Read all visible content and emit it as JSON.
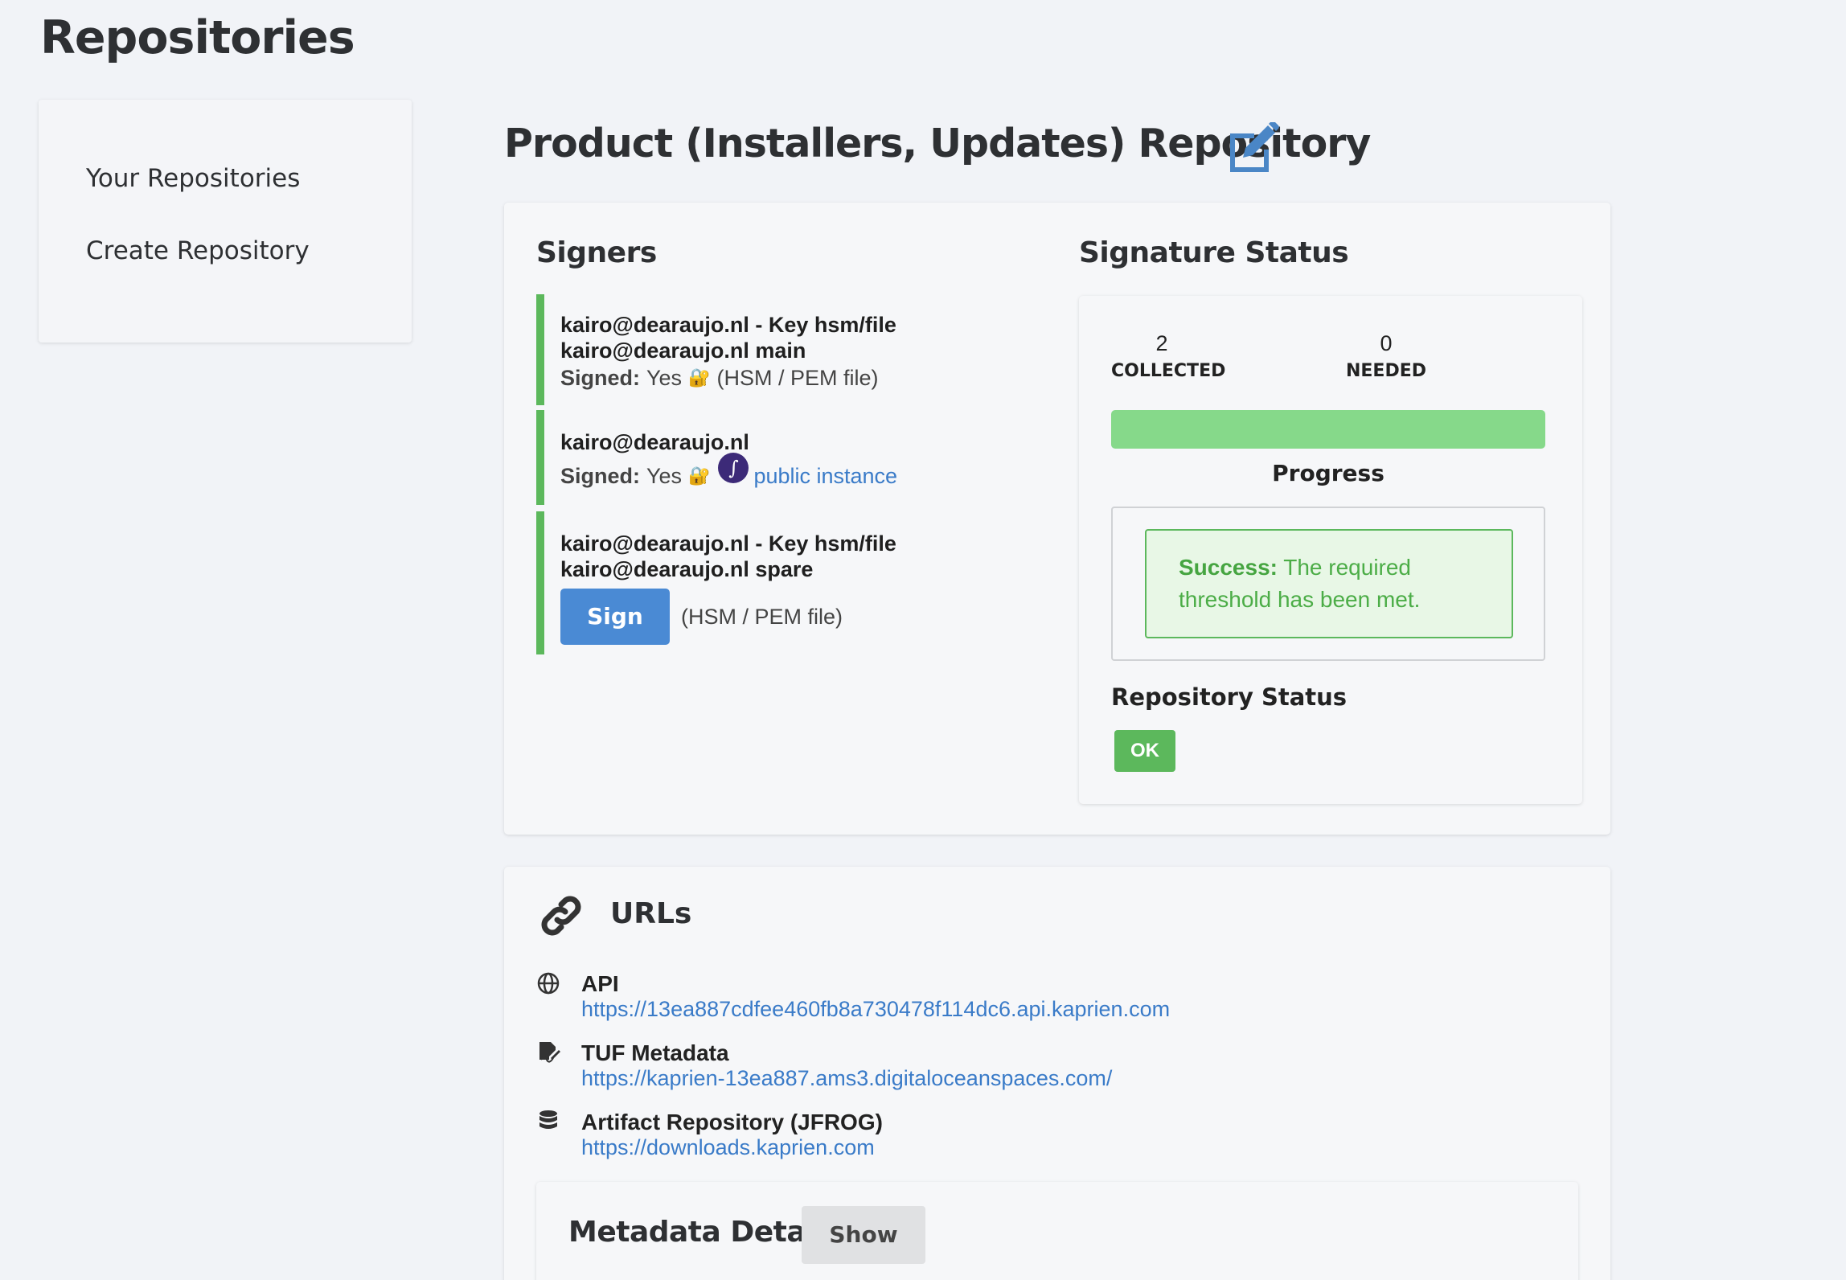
{
  "page_title": "Repositories",
  "sidebar": {
    "items": [
      {
        "label": "Your Repositories"
      },
      {
        "label": "Create Repository"
      }
    ]
  },
  "repo": {
    "title": "Product (Installers, Updates) Repository",
    "edit_icon": "edit-icon"
  },
  "signers": {
    "heading": "Signers",
    "list": [
      {
        "line1": "kairo@dearaujo.nl - Key hsm/file",
        "line2": "kairo@dearaujo.nl main",
        "signed_label": "Signed:",
        "signed_value": "Yes",
        "method": "(HSM / PEM file)"
      },
      {
        "line1": "kairo@dearaujo.nl",
        "signed_label": "Signed:",
        "signed_value": "Yes",
        "method": "public instance"
      },
      {
        "line1": "kairo@dearaujo.nl - Key hsm/file",
        "line2": "kairo@dearaujo.nl spare",
        "sign_button": "Sign",
        "method": "(HSM / PEM file)"
      }
    ]
  },
  "signature_status": {
    "heading": "Signature Status",
    "collected": "2",
    "collected_label": "COLLECTED",
    "needed": "0",
    "needed_label": "NEEDED",
    "progress_fraction": 1.0,
    "progress_label": "Progress",
    "alert_strong": "Success:",
    "alert_text": "The required threshold has been met.",
    "repo_status_heading": "Repository Status",
    "repo_status_badge": "OK"
  },
  "urls": {
    "heading": "URLs",
    "items": [
      {
        "name": "API",
        "url": "https://13ea887cdfee460fb8a730478f114dc6.api.kaprien.com",
        "icon": "globe-icon"
      },
      {
        "name": "TUF Metadata",
        "url": "https://kaprien-13ea887.ams3.digitaloceanspaces.com/",
        "icon": "file-signature-icon"
      },
      {
        "name": "Artifact Repository (JFROG)",
        "url": "https://downloads.kaprien.com",
        "icon": "database-icon"
      }
    ]
  },
  "metadata": {
    "heading": "Metadata Details",
    "show_button": "Show"
  },
  "colors": {
    "accent_blue": "#4a8ad4",
    "success_green": "#5cb85c",
    "progress_green": "#86d98a",
    "link_blue": "#3a7bc8"
  }
}
